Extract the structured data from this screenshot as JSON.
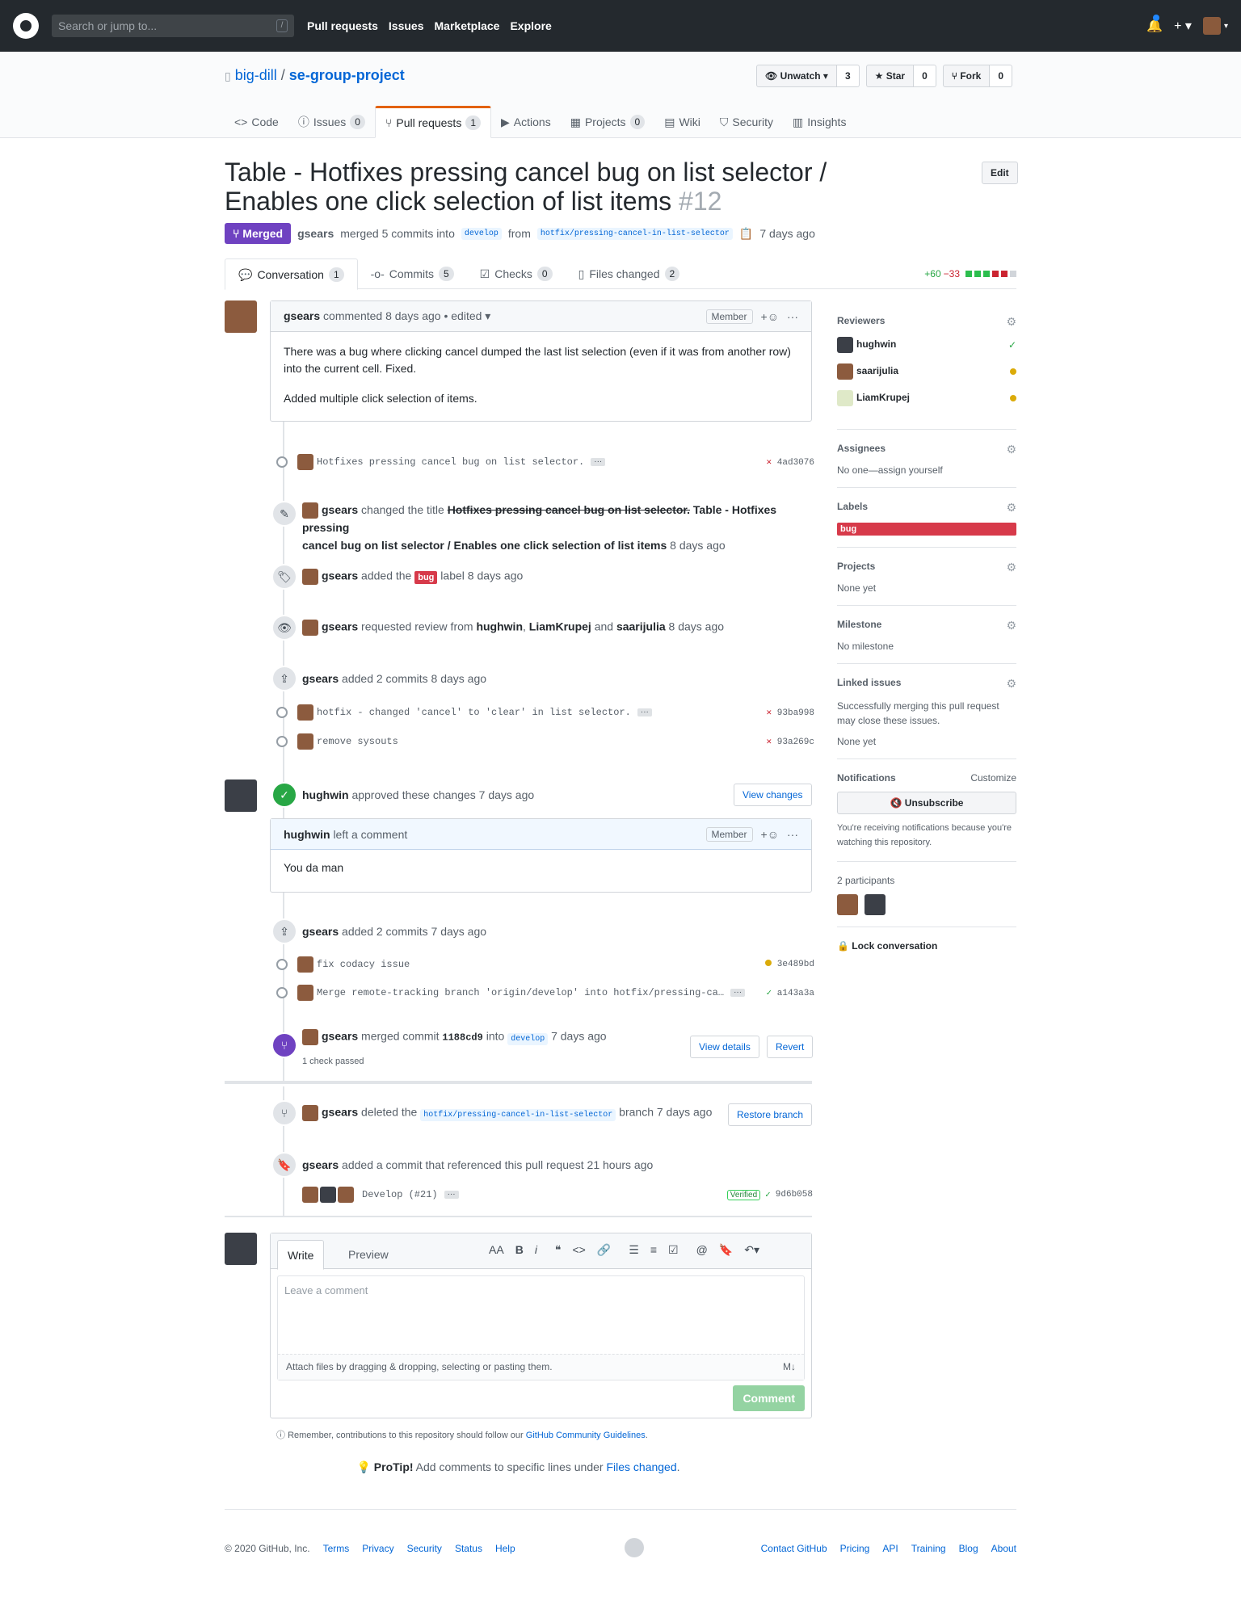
{
  "header": {
    "search_placeholder": "Search or jump to...",
    "slash": "/",
    "nav": [
      "Pull requests",
      "Issues",
      "Marketplace",
      "Explore"
    ]
  },
  "repo": {
    "owner": "big-dill",
    "name": "se-group-project",
    "watch": "Unwatch",
    "watch_count": "3",
    "star": "Star",
    "star_count": "0",
    "fork": "Fork",
    "fork_count": "0"
  },
  "tabs": [
    {
      "label": "Code"
    },
    {
      "label": "Issues",
      "count": "0"
    },
    {
      "label": "Pull requests",
      "count": "1"
    },
    {
      "label": "Actions"
    },
    {
      "label": "Projects",
      "count": "0"
    },
    {
      "label": "Wiki"
    },
    {
      "label": "Security"
    },
    {
      "label": "Insights"
    }
  ],
  "pr": {
    "title": "Table - Hotfixes pressing cancel bug on list selector / Enables one click selection of list items",
    "number": "#12",
    "edit": "Edit",
    "state": "Merged",
    "author": "gsears",
    "merge_text": "merged 5 commits into",
    "base": "develop",
    "from": "from",
    "head": "hotfix/pressing-cancel-in-list-selector",
    "when": "7 days ago"
  },
  "ptabs": [
    {
      "label": "Conversation",
      "count": "1"
    },
    {
      "label": "Commits",
      "count": "5"
    },
    {
      "label": "Checks",
      "count": "0"
    },
    {
      "label": "Files changed",
      "count": "2"
    }
  ],
  "diff": {
    "add": "+60",
    "del": "−33"
  },
  "first_comment": {
    "author": "gsears",
    "meta": "commented 8 days ago • edited",
    "role": "Member",
    "p1": "There was a bug where clicking cancel dumped the last list selection (even if it was from another row) into the current cell. Fixed.",
    "p2": "Added multiple click selection of items."
  },
  "c1": {
    "msg": "Hotfixes pressing cancel bug on list selector.",
    "sha": "4ad3076"
  },
  "ev_title": {
    "author": "gsears",
    "text": "changed the title",
    "old": "Hotfixes pressing cancel bug on list selector.",
    "new1": "Table - Hotfixes pressing",
    "new2": "cancel bug on list selector / Enables one click selection of list items",
    "when": "8 days ago"
  },
  "ev_label": {
    "author": "gsears",
    "text": "added the",
    "label": "bug",
    "text2": "label 8 days ago"
  },
  "ev_review": {
    "author": "gsears",
    "text": "requested review from",
    "r1": "hughwin",
    "r2": "LiamKrupej",
    "and": "and",
    "r3": "saarijulia",
    "when": "8 days ago"
  },
  "ev_commits1": {
    "author": "gsears",
    "text": "added 2 commits 8 days ago"
  },
  "c2": {
    "msg": "hotfix - changed 'cancel' to 'clear' in list selector.",
    "sha": "93ba998"
  },
  "c3": {
    "msg": "remove sysouts",
    "sha": "93a269c"
  },
  "approve": {
    "author": "hughwin",
    "text": "approved these changes 7 days ago",
    "btn": "View changes"
  },
  "review_comment": {
    "author": "hughwin",
    "text": "left a comment",
    "role": "Member",
    "body": "You da man"
  },
  "ev_commits2": {
    "author": "gsears",
    "text": "added 2 commits 7 days ago"
  },
  "c4": {
    "msg": "fix codacy issue",
    "sha": "3e489bd"
  },
  "c5": {
    "msg": "Merge remote-tracking branch 'origin/develop' into hotfix/pressing-ca…",
    "sha": "a143a3a"
  },
  "merge_ev": {
    "author": "gsears",
    "text": "merged commit",
    "sha": "1188cd9",
    "into": "into",
    "base": "develop",
    "when": "7 days ago",
    "checks": "1 check passed",
    "details": "View details",
    "revert": "Revert"
  },
  "deleted": {
    "author": "gsears",
    "text": "deleted the",
    "branch": "hotfix/pressing-cancel-in-list-selector",
    "text2": "branch 7 days ago",
    "btn": "Restore branch"
  },
  "ref_ev": {
    "author": "gsears",
    "text": "added a commit that referenced this pull request 21 hours ago",
    "msg": "Develop (#21)",
    "verified": "Verified",
    "sha": "9d6b058"
  },
  "editor": {
    "write": "Write",
    "preview": "Preview",
    "placeholder": "Leave a comment",
    "attach": "Attach files by dragging & dropping, selecting or pasting them.",
    "submit": "Comment",
    "remember": "Remember, contributions to this repository should follow our",
    "guidelines": "GitHub Community Guidelines",
    "protip": "ProTip!",
    "protip_text": "Add comments to specific lines under",
    "files_changed": "Files changed"
  },
  "sidebar": {
    "reviewers": "Reviewers",
    "reviewer_list": [
      "hughwin",
      "saarijulia",
      "LiamKrupej"
    ],
    "assignees": "Assignees",
    "assignees_text": "No one—assign yourself",
    "labels": "Labels",
    "label": "bug",
    "projects": "Projects",
    "projects_text": "None yet",
    "milestone": "Milestone",
    "milestone_text": "No milestone",
    "linked": "Linked issues",
    "linked_text": "Successfully merging this pull request may close these issues.",
    "linked_none": "None yet",
    "notifications": "Notifications",
    "customize": "Customize",
    "unsubscribe": "Unsubscribe",
    "notif_text": "You're receiving notifications because you're watching this repository.",
    "participants": "2 participants",
    "lock": "Lock conversation"
  },
  "footer": {
    "copy": "© 2020 GitHub, Inc.",
    "left": [
      "Terms",
      "Privacy",
      "Security",
      "Status",
      "Help"
    ],
    "right": [
      "Contact GitHub",
      "Pricing",
      "API",
      "Training",
      "Blog",
      "About"
    ]
  }
}
